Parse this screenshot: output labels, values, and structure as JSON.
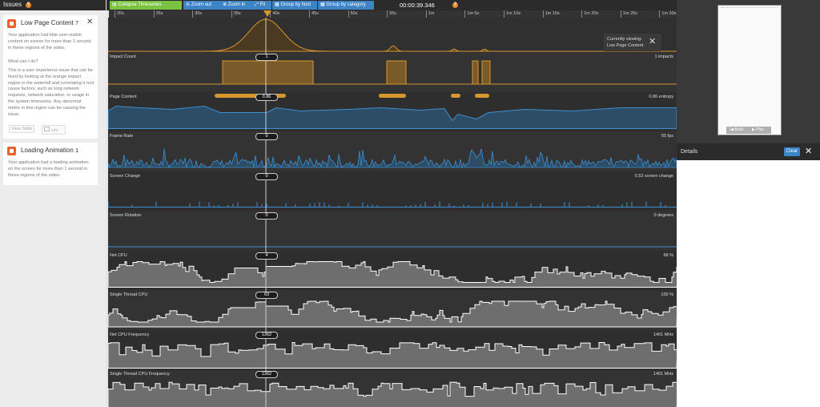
{
  "issues": {
    "header": "Issues",
    "cards": [
      {
        "title": "Low Page Content",
        "count": "7",
        "desc1": "Your application had little user-visible content on screen for more than 1 second in these regions of the video.",
        "what": "What can I do?",
        "desc2": "This is a user experience issue that can be fixed by looking at the orange impact region in the waterfall and correlating it root cause factors, such as long network requests, network saturation, or usage in the system timeseries. Any abnormal metric in this region can be causing the issue.",
        "view_table": "View Table",
        "csv": "csv"
      },
      {
        "title": "Loading Animation",
        "count": "1",
        "desc1": "Your application had a loading animation on the screen for more than 1 second in these regions of the video."
      }
    ]
  },
  "toolbar": {
    "collapse": "Collapse Timeseries",
    "zoom_out": "Zoom out",
    "zoom_in": "Zoom in",
    "fit": "Fit",
    "group_host": "Group by host",
    "group_category": "Group by category",
    "clock": "00:00:39.346"
  },
  "timeline": [
    "20s",
    "25s",
    "30s",
    "35s",
    "40s",
    "45s",
    "50s",
    "55s",
    "1m",
    "1m 5s",
    "1m 10s",
    "1m 15s",
    "1m 20s",
    "1m 25s",
    "1m 30s"
  ],
  "tracks": [
    {
      "label": "Impact Count",
      "badge": "1",
      "value": "1 impacts"
    },
    {
      "label": "Page Content",
      "badge": "0.86",
      "value": "0.86 entropy"
    },
    {
      "label": "Frame Rate",
      "badge": "0",
      "value": "55 fps"
    },
    {
      "label": "Screen Change",
      "badge": "0",
      "value": "0.52 screen change"
    },
    {
      "label": "Screen Rotation",
      "badge": "0",
      "value": "0 degrees"
    },
    {
      "label": "Net CPU",
      "badge": "4",
      "value": "68 %"
    },
    {
      "label": "Single Thread CPU",
      "badge": "63",
      "value": "100 %"
    },
    {
      "label": "Net CPU Frequency",
      "badge": "1362",
      "value": "1401 MHz"
    },
    {
      "label": "Single Thread CPU Frequency",
      "badge": "1362",
      "value": "1401 MHz"
    }
  ],
  "current_view": {
    "line1": "Currently viewing:",
    "line2": "Low Page Content"
  },
  "phone": {
    "back": "Back",
    "play": "Play"
  },
  "details": {
    "title": "Details",
    "clear": "Clear"
  },
  "colors": {
    "orange": "#d8962f",
    "blue": "#3d8fd1",
    "white": "#ffffff",
    "accent": "#3c84c5",
    "green": "#7cc242"
  }
}
